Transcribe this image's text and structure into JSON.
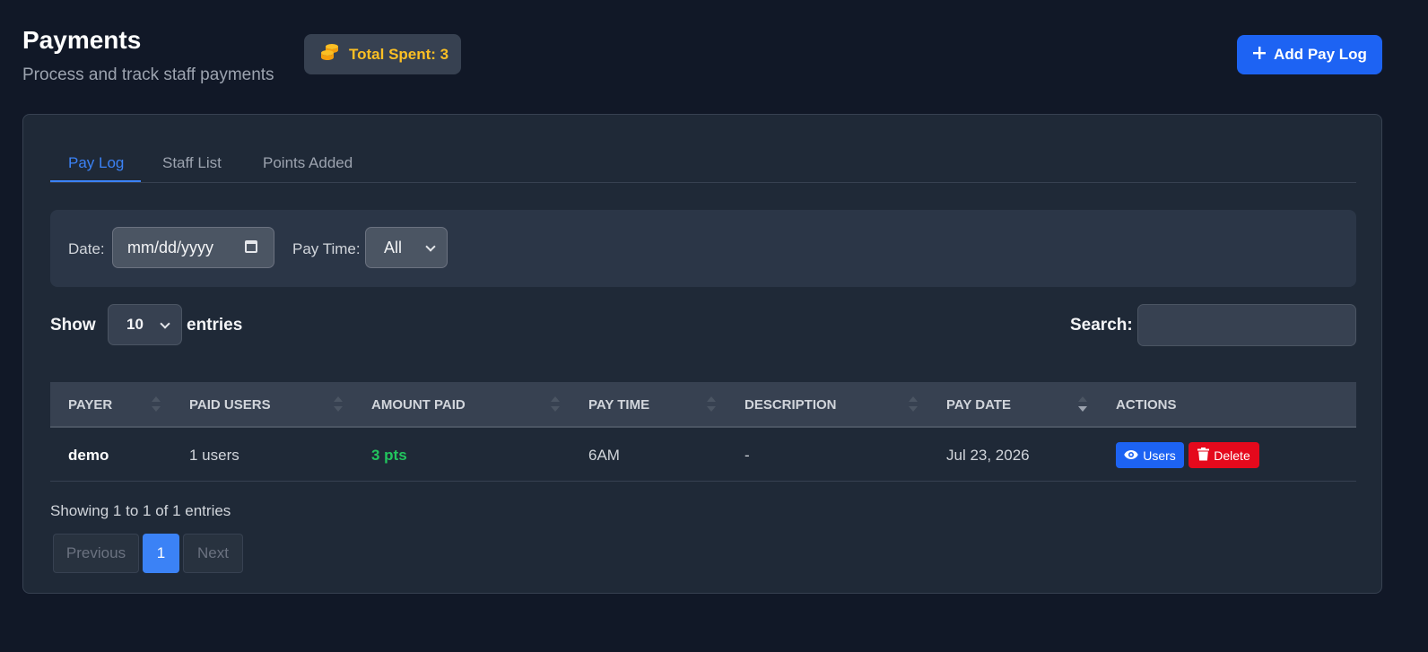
{
  "header": {
    "title": "Payments",
    "subtitle": "Process and track staff payments",
    "total_spent": "Total Spent: 3",
    "add_button": "Add Pay Log"
  },
  "tabs": [
    {
      "label": "Pay Log",
      "active": true
    },
    {
      "label": "Staff List",
      "active": false
    },
    {
      "label": "Points Added",
      "active": false
    }
  ],
  "filters": {
    "date_label": "Date:",
    "date_placeholder": "mm/dd/yyyy",
    "paytime_label": "Pay Time:",
    "paytime_value": "All"
  },
  "entries": {
    "show_label": "Show",
    "page_size": "10",
    "entries_label": "entries",
    "search_label": "Search:"
  },
  "table": {
    "columns": [
      "PAYER",
      "PAID USERS",
      "AMOUNT PAID",
      "PAY TIME",
      "DESCRIPTION",
      "PAY DATE",
      "ACTIONS"
    ],
    "rows": [
      {
        "payer": "demo",
        "paid_users": "1 users",
        "amount": "3 pts",
        "pay_time": "6AM",
        "description": "-",
        "pay_date": "Jul 23, 2026",
        "users_button": "Users",
        "delete_button": "Delete"
      }
    ]
  },
  "footer": {
    "showing": "Showing 1 to 1 of 1 entries",
    "previous": "Previous",
    "current_page": "1",
    "next": "Next"
  },
  "colors": {
    "background": "#111827",
    "card": "#1f2937",
    "accent": "#1d63f3",
    "active_tab": "#3b82f6",
    "gold": "#fbbf24",
    "success": "#22c55e",
    "danger": "#e5091c"
  },
  "icons": {
    "badge": "coins-icon",
    "add": "plus-icon",
    "date": "calendar-icon",
    "users": "eye-icon",
    "delete": "trash-icon"
  }
}
